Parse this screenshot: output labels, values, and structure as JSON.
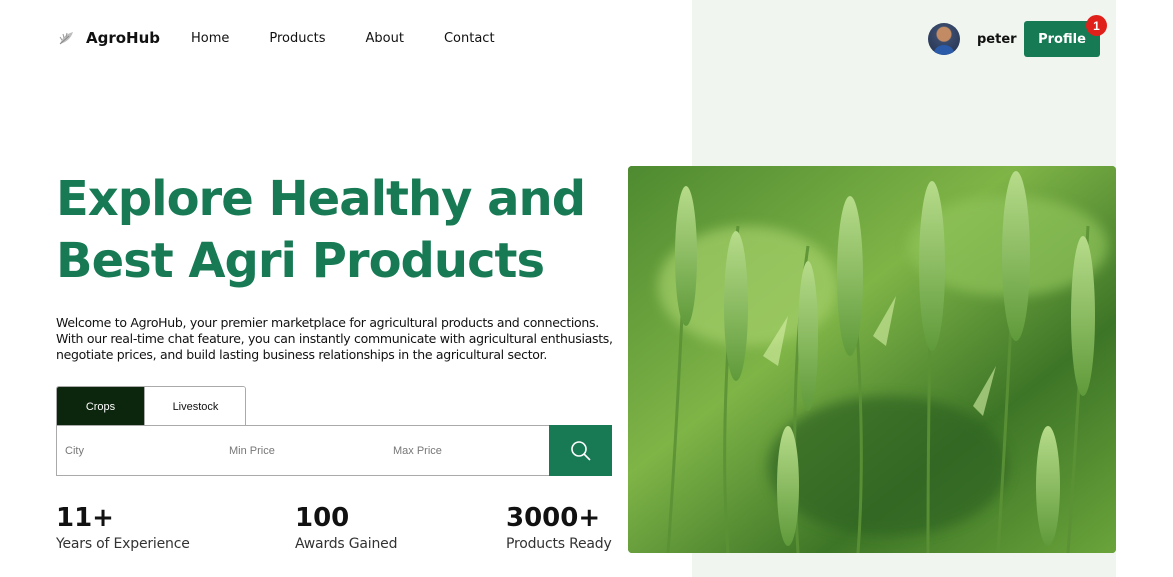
{
  "header": {
    "logo_text": "AgroHub",
    "nav": [
      "Home",
      "Products",
      "About",
      "Contact"
    ],
    "username": "peter",
    "profile_label": "Profile",
    "notification_count": "1"
  },
  "hero": {
    "title_line1": "Explore Healthy and",
    "title_line2": "Best Agri Products",
    "description": "Welcome to AgroHub, your premier marketplace for agricultural products and connections. With our real-time chat feature, you can instantly communicate with agricultural enthusiasts, negotiate prices, and build lasting business relationships in the agricultural sector."
  },
  "search": {
    "tabs": [
      "Crops",
      "Livestock"
    ],
    "active_tab": "Crops",
    "city_placeholder": "City",
    "min_price_placeholder": "Min Price",
    "max_price_placeholder": "Max Price"
  },
  "stats": [
    {
      "value": "11+",
      "label": "Years of Experience"
    },
    {
      "value": "100",
      "label": "Awards Gained"
    },
    {
      "value": "3000+",
      "label": "Products Ready"
    }
  ],
  "colors": {
    "accent": "#177a55",
    "dark_tab": "#0c260e",
    "badge": "#e0201b",
    "panel_bg": "#f0f6ef"
  }
}
